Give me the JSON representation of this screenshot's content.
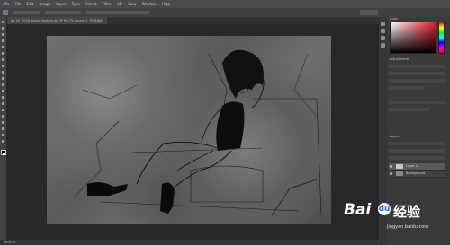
{
  "app": {
    "menu": [
      "Ps",
      "File",
      "Edit",
      "Image",
      "Layer",
      "Type",
      "Select",
      "Filter",
      "3D",
      "View",
      "Window",
      "Help"
    ],
    "doc_tab": "ps_04_2016_stone_texture.jpg @ 66.7% (Layer 1, RGB/8#)",
    "status": "66.67%"
  },
  "panels": {
    "color_tab": "Color",
    "adjust_tab": "Adjustments",
    "layers_tab": "Layers",
    "layers": [
      {
        "name": "Layer 1",
        "selected": true
      },
      {
        "name": "Background",
        "selected": false
      }
    ]
  },
  "watermark": {
    "brand": "Bai",
    "suffix": "经验",
    "url": "jingyan.baidu.com"
  },
  "colors": {
    "accent": "#e21b2c",
    "panel": "#3a3a3a",
    "menubar": "#4a4a4a"
  }
}
